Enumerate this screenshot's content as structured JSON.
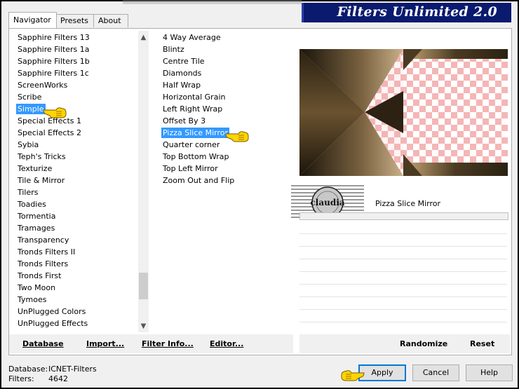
{
  "window": {
    "title": "Filters Unlimited 2.0"
  },
  "tabs": [
    {
      "label": "Navigator"
    },
    {
      "label": "Presets"
    },
    {
      "label": "About"
    }
  ],
  "categories": {
    "items": [
      "Sapphire Filters 13",
      "Sapphire Filters 1a",
      "Sapphire Filters 1b",
      "Sapphire Filters 1c",
      "ScreenWorks",
      "Scribe",
      "Simple",
      "Special Effects 1",
      "Special Effects 2",
      "Sybia",
      "Teph's Tricks",
      "Texturize",
      "Tile & Mirror",
      "Tilers",
      "Toadies",
      "Tormentia",
      "Tramages",
      "Transparency",
      "Tronds Filters II",
      "Tronds Filters",
      "Tronds First",
      "Two Moon",
      "Tymoes",
      "UnPlugged Colors",
      "UnPlugged Effects"
    ],
    "selected": "Simple"
  },
  "filters": {
    "items": [
      "4 Way Average",
      "Blintz",
      "Centre Tile",
      "Diamonds",
      "Half Wrap",
      "Horizontal Grain",
      "Left Right Wrap",
      "Offset By 3",
      "Pizza Slice Mirror",
      "Quarter corner",
      "Top Bottom Wrap",
      "Top Left Mirror",
      "Zoom Out and Flip"
    ],
    "selected": "Pizza Slice Mirror"
  },
  "preset": {
    "name": "Pizza Slice Mirror",
    "logo_text": "claudia"
  },
  "toolbar_left": {
    "database": "Database",
    "import": "Import...",
    "filter_info": "Filter Info...",
    "editor": "Editor..."
  },
  "toolbar_right": {
    "randomize": "Randomize",
    "reset": "Reset"
  },
  "status": {
    "database_label": "Database:",
    "database_value": "ICNET-Filters",
    "filters_label": "Filters:",
    "filters_value": "4642"
  },
  "buttons": {
    "apply": "Apply",
    "cancel": "Cancel",
    "help": "Help"
  },
  "colors": {
    "selection": "#3399ff",
    "title_bg": "#0a1a6e",
    "pointer_hand": "#ffd400"
  }
}
